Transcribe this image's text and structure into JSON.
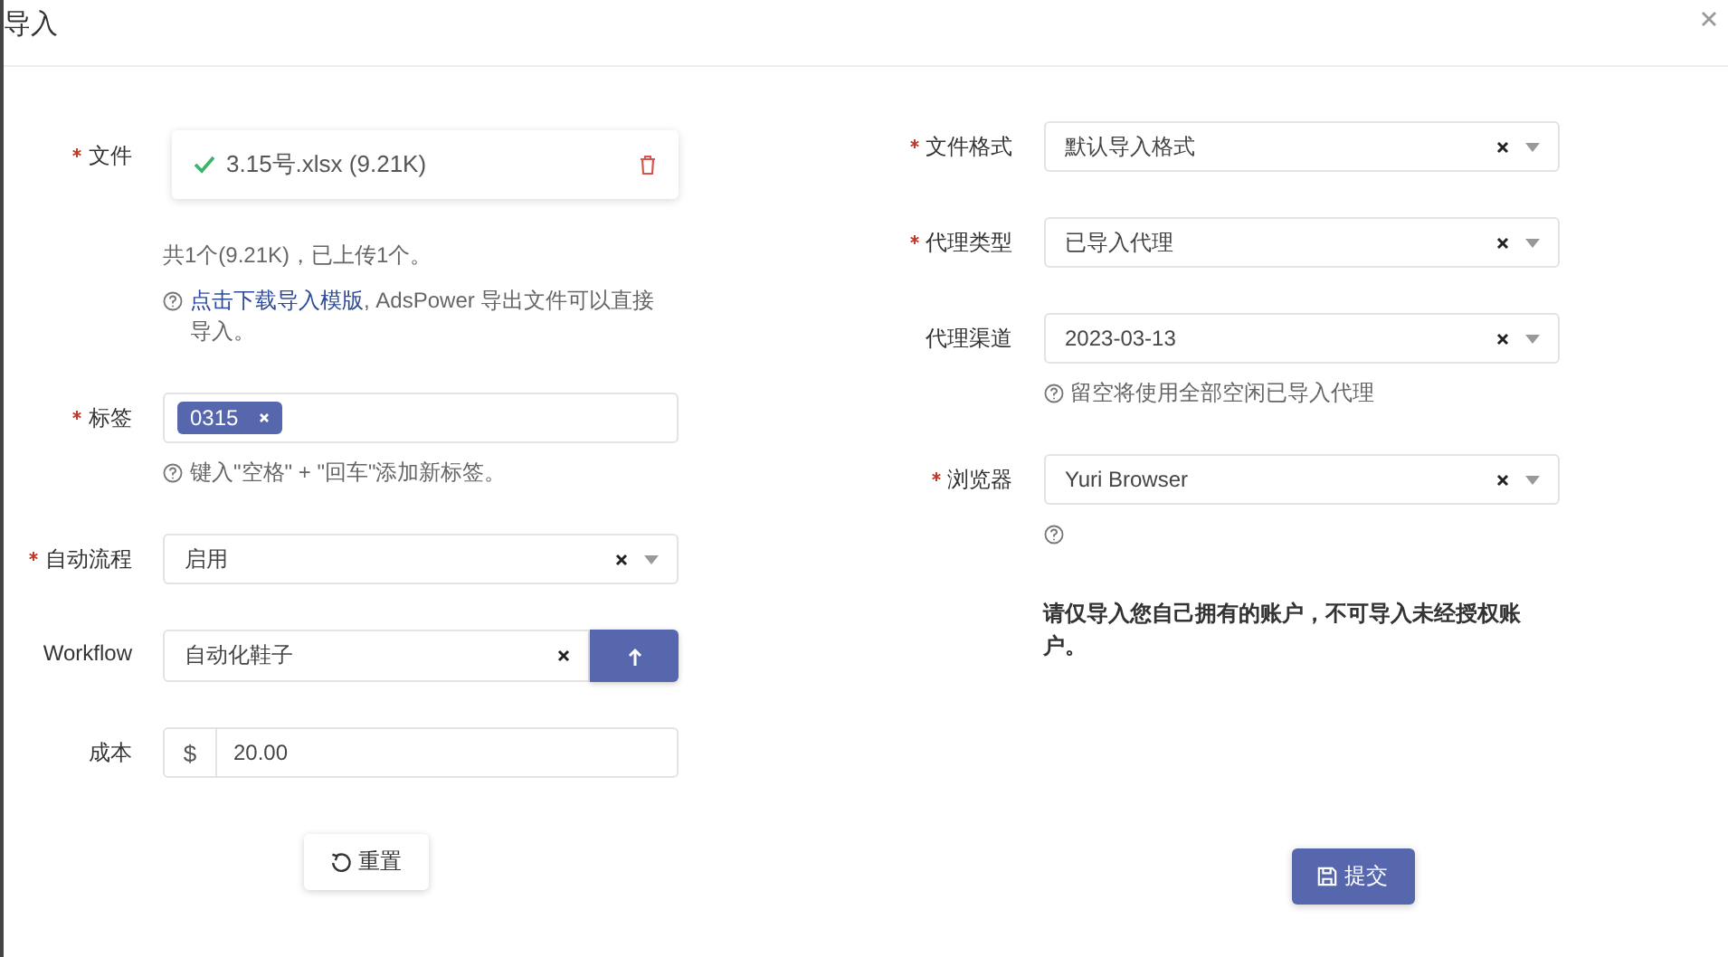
{
  "dialog": {
    "title": "导入"
  },
  "left_fields": [
    {
      "kind": "file",
      "label": "文件",
      "required": true,
      "file": "3.15号.xlsx (9.21K)",
      "uploaded": true,
      "summary": "共1个(9.21K)，已上传1个。",
      "help_link": "点击下载导入模版",
      "help_text": ", AdsPower 导出文件可以直接导入。"
    },
    {
      "kind": "tags",
      "label": "标签",
      "required": true,
      "tags": [
        "0315"
      ],
      "help": "键入\"空格\" + \"回车\"添加新标签。"
    },
    {
      "kind": "select",
      "label": "自动流程",
      "required": true,
      "value": "启用"
    },
    {
      "kind": "upload",
      "label": "Workflow",
      "required": false,
      "value": "自动化鞋子"
    },
    {
      "kind": "money",
      "label": "成本",
      "required": false,
      "prefix": "$",
      "value": "20.00"
    }
  ],
  "right_fields": [
    {
      "kind": "select",
      "label": "文件格式",
      "required": true,
      "value": "默认导入格式"
    },
    {
      "kind": "select",
      "label": "代理类型",
      "required": true,
      "value": "已导入代理"
    },
    {
      "kind": "select",
      "label": "代理渠道",
      "required": false,
      "value": "2023-03-13",
      "help": "留空将使用全部空闲已导入代理"
    },
    {
      "kind": "select",
      "label": "浏览器",
      "required": true,
      "value": "Yuri Browser",
      "help_icon": true
    },
    {
      "kind": "notice",
      "text": "请仅导入您自己拥有的账户，不可导入未经授权账户。"
    }
  ],
  "buttons": [
    {
      "kind": "reset",
      "label": "重置"
    },
    {
      "kind": "submit",
      "label": "提交"
    }
  ]
}
